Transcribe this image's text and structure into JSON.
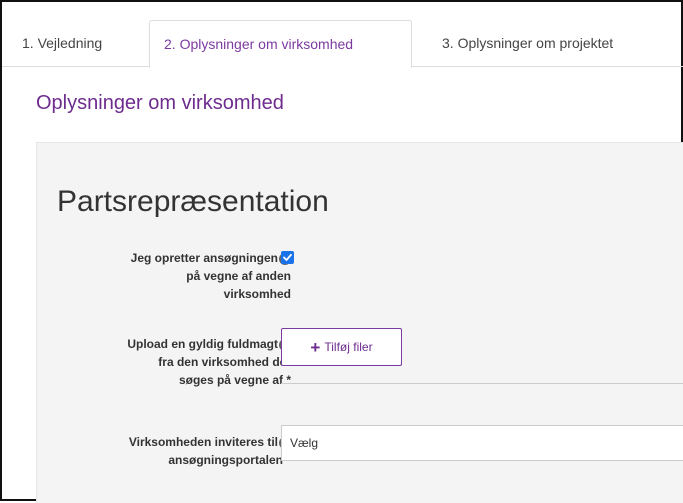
{
  "tabs": [
    {
      "label": "1. Vejledning"
    },
    {
      "label": "2. Oplysninger om virksomhed"
    },
    {
      "label": "3. Oplysninger om projektet"
    }
  ],
  "section_heading": "Oplysninger om virksomhed",
  "panel": {
    "title": "Partsrepræsentation",
    "fields": [
      {
        "label_lines": [
          "Jeg opretter ansøgningen",
          "på vegne af anden",
          "virksomhed"
        ],
        "checked": true
      },
      {
        "label_lines": [
          "Upload en gyldig fuldmagt",
          "fra den virksomhed der",
          "søges på vegne af *"
        ],
        "button_label": "Tilføj filer"
      },
      {
        "label_lines": [
          "Virksomheden inviteres til",
          "ansøgningsportalen *"
        ],
        "select_value": "Vælg"
      }
    ]
  },
  "colors": {
    "accent": "#6d2c8e",
    "checkbox": "#1a73e8",
    "panel_bg": "#f4f4f4"
  },
  "icons": {
    "help": "question-circle-icon",
    "check": "check-icon",
    "plus": "plus-icon"
  }
}
